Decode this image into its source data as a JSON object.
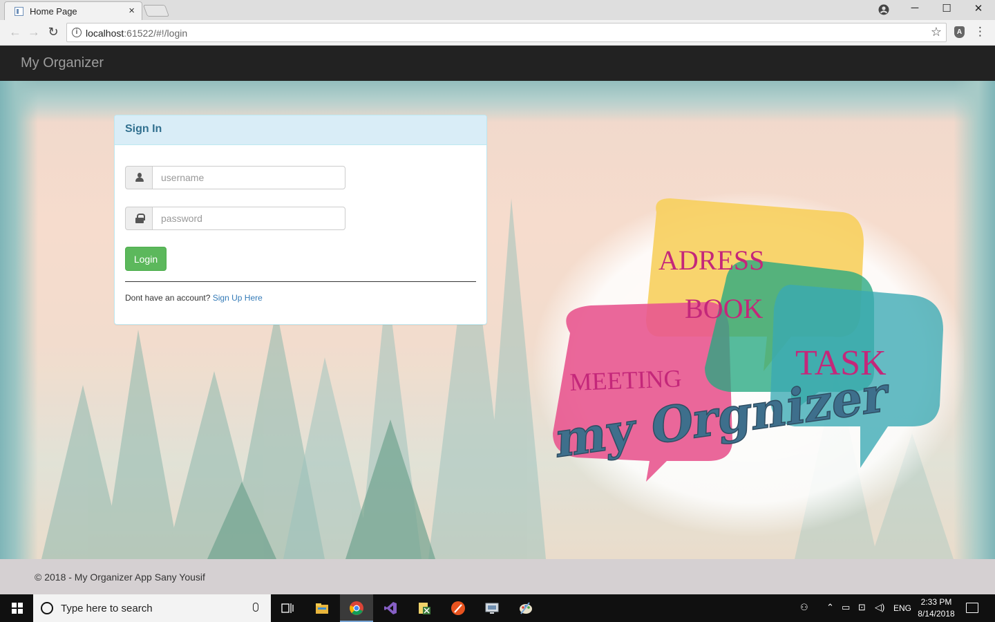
{
  "browser": {
    "tab_title": "Home Page",
    "tab_close": "×",
    "url_host": "localhost",
    "url_path": ":61522/#!/login",
    "window_controls": [
      "─",
      "☐",
      "✕"
    ]
  },
  "navbar": {
    "brand": "My Organizer"
  },
  "signin": {
    "title": "Sign In",
    "username_placeholder": "username",
    "password_placeholder": "password",
    "login_label": "Login",
    "no_account_text": "Dont have an account?",
    "signup_link": "Sign Up Here"
  },
  "logo": {
    "words": [
      "ADRESS",
      "BOOK",
      "MEETING",
      "TASK"
    ],
    "wordmark": "my Orgnizer",
    "colors": {
      "yellow": "#f7cf5d",
      "pink": "#e8578f",
      "green": "#27a880",
      "teal": "#3aa9b3",
      "text_pink": "#c4277a",
      "wordmark": "#3e6f8c"
    }
  },
  "footer": {
    "text": "© 2018 - My Organizer App Sany Yousif"
  },
  "taskbar": {
    "search_placeholder": "Type here to search",
    "apps": [
      "task-view",
      "file-explorer",
      "chrome",
      "visual-studio",
      "app-notepad",
      "app-paint",
      "app-remote",
      "app-explorer"
    ],
    "language": "ENG",
    "time": "2:33 PM",
    "date": "8/14/2018"
  }
}
